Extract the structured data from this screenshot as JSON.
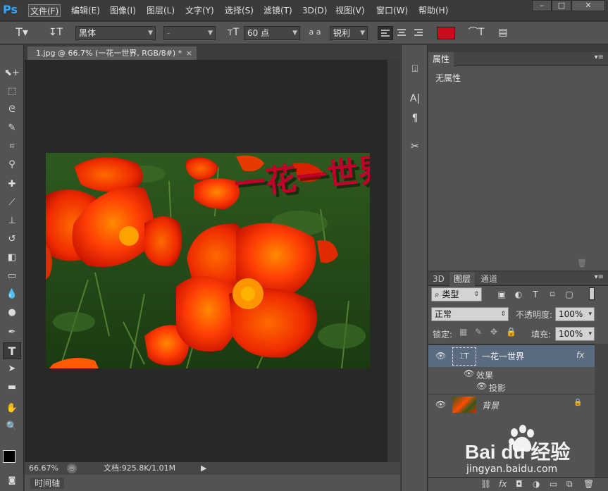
{
  "app": {
    "logo": "Ps",
    "menus": [
      "文件(F)",
      "编辑(E)",
      "图像(I)",
      "图层(L)",
      "文字(Y)",
      "选择(S)",
      "滤镜(T)",
      "3D(D)",
      "视图(V)",
      "窗口(W)",
      "帮助(H)"
    ]
  },
  "options": {
    "font_family": "黑体",
    "font_style": "-",
    "font_size": "60 点",
    "aa_label": "a a",
    "antialias": "锐利",
    "color": "#cc0a1e"
  },
  "document": {
    "tab_title": "1.jpg @ 66.7% (一花一世界, RGB/8#) *",
    "close": "×",
    "watermark_text": "一花一世界"
  },
  "status": {
    "zoom": "66.67%",
    "doc_info": "文档:925.8K/1.01M"
  },
  "timeline": {
    "label": "时间轴"
  },
  "properties": {
    "tab": "属性",
    "content": "无属性"
  },
  "layers_panel": {
    "tabs": [
      "3D",
      "图层",
      "通道"
    ],
    "filter_label": "类型",
    "blend_mode": "正常",
    "opacity_label": "不透明度:",
    "opacity": "100%",
    "lock_label": "锁定:",
    "fill_label": "填充:",
    "fill": "100%",
    "layers": [
      {
        "name": "一花一世界",
        "fx": "fx"
      },
      {
        "name": "效果"
      },
      {
        "name": "投影"
      },
      {
        "name": "背景"
      }
    ]
  },
  "overlay": {
    "brand": "Bai du 经验",
    "url": "jingyan.baidu.com"
  }
}
